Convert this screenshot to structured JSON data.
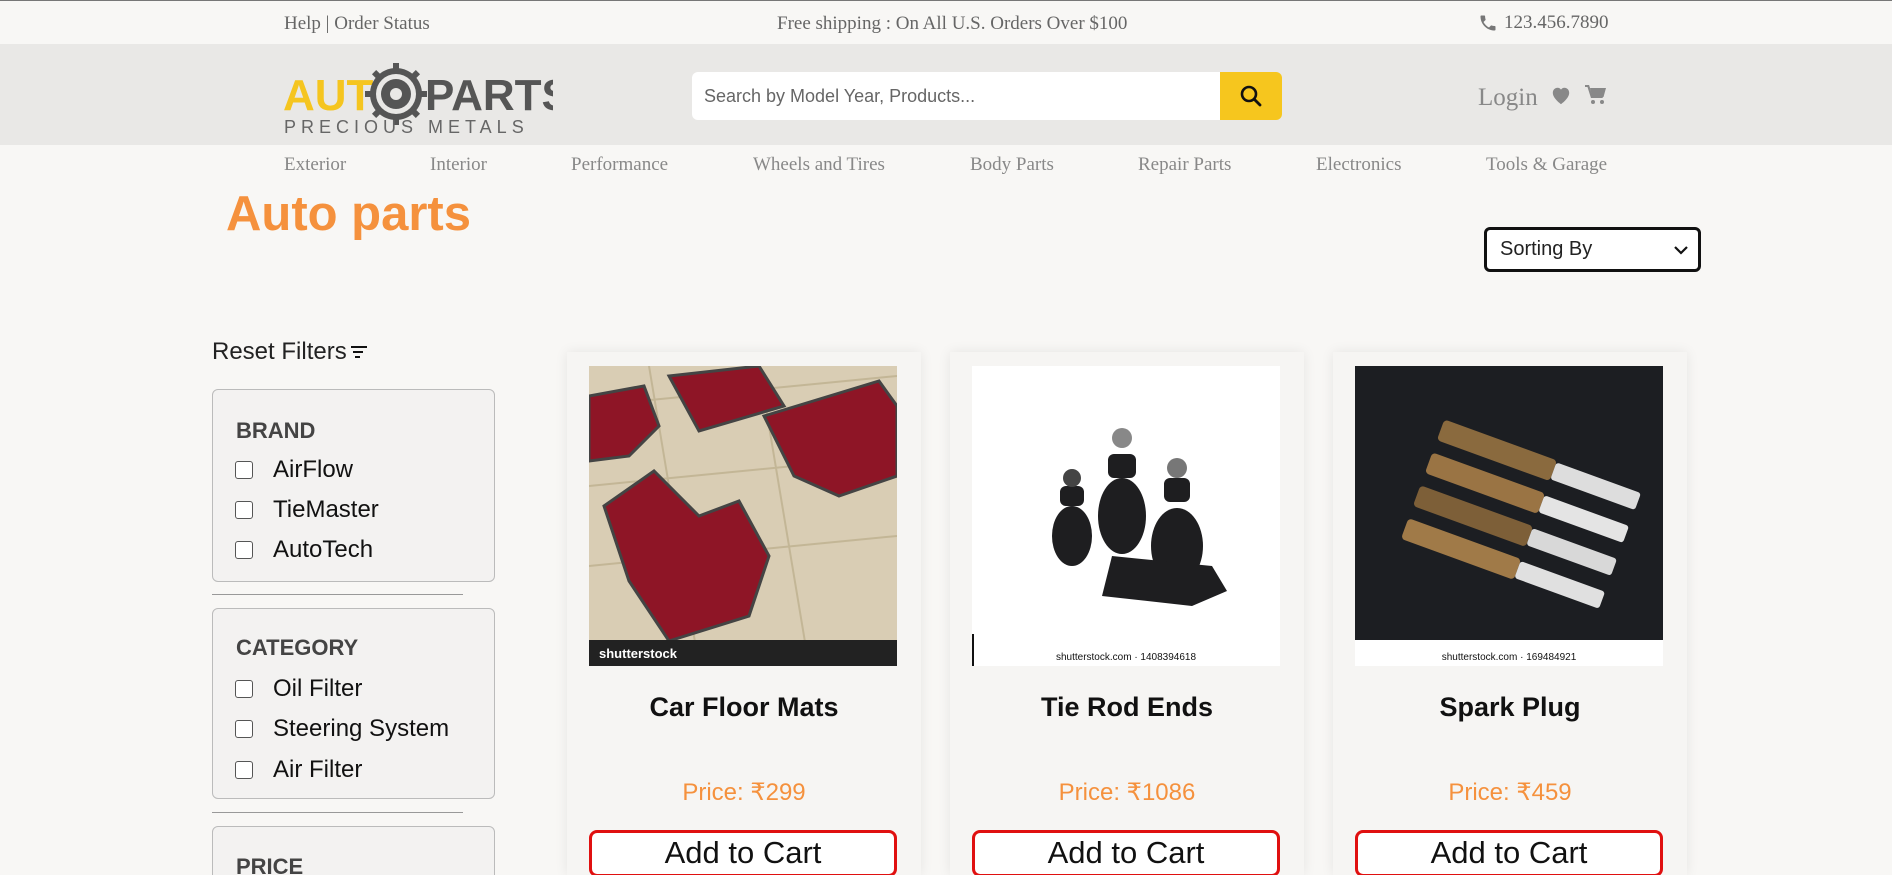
{
  "topbar": {
    "help_links": "Help | Order Status",
    "shipping": "Free shipping : On All U.S. Orders Over $100",
    "phone": "123.456.7890"
  },
  "header": {
    "logo_text_auto": "AUT",
    "logo_text_parts": "PARTS",
    "logo_sub": "PRECIOUS METALS",
    "search_placeholder": "Search by Model Year, Products...",
    "login": "Login"
  },
  "nav": [
    "Exterior",
    "Interior",
    "Performance",
    "Wheels and Tires",
    "Body Parts",
    "Repair Parts",
    "Electronics",
    "Tools & Garage"
  ],
  "page": {
    "title": "Auto parts",
    "sort_label": "Sorting By",
    "reset_filters": "Reset Filters"
  },
  "filters": {
    "brand": {
      "title": "BRAND",
      "options": [
        "AirFlow",
        "TieMaster",
        "AutoTech"
      ]
    },
    "category": {
      "title": "CATEGORY",
      "options": [
        "Oil Filter",
        "Steering System",
        "Air Filter"
      ]
    },
    "price": {
      "title": "PRICE"
    }
  },
  "products": [
    {
      "name": "Car Floor Mats",
      "price": "Price: ₹299",
      "button": "Add to Cart",
      "watermark": "shutterstock"
    },
    {
      "name": "Tie Rod Ends",
      "price": "Price: ₹1086",
      "button": "Add to Cart",
      "watermark": "shutterstock.com · 1408394618"
    },
    {
      "name": "Spark Plug",
      "price": "Price: ₹459",
      "button": "Add to Cart",
      "watermark": "shutterstock.com · 169484921"
    }
  ],
  "colors": {
    "accent_orange": "#f5913d",
    "search_yellow": "#f6c61e",
    "cart_red": "#e01010"
  }
}
